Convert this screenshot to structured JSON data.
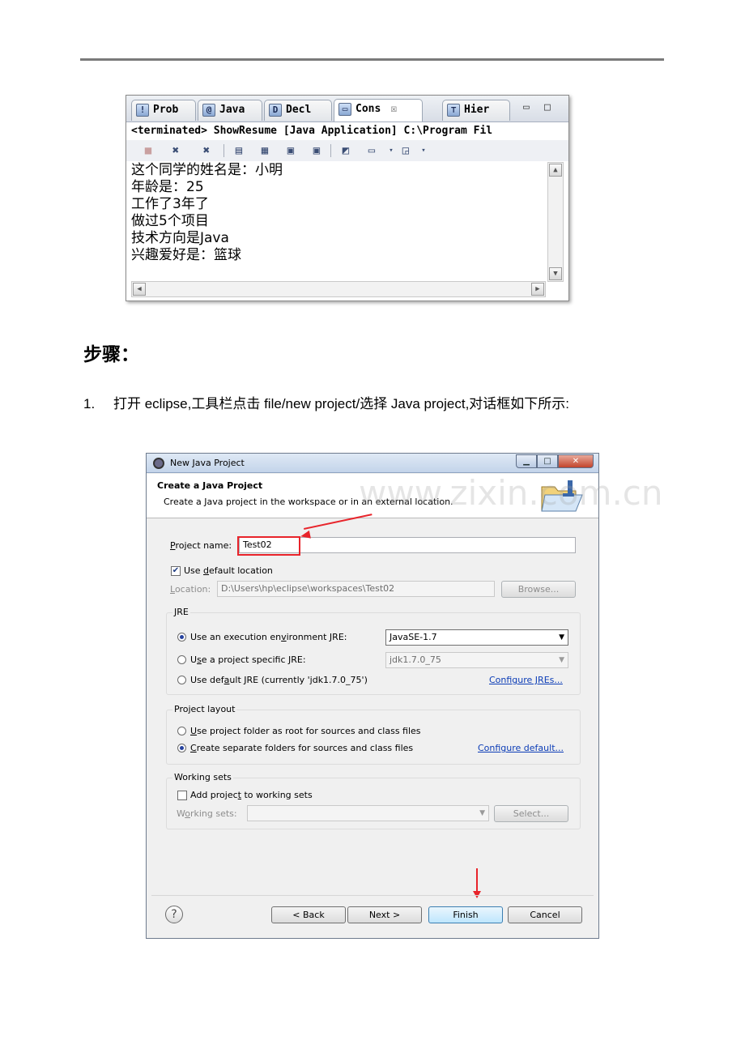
{
  "console": {
    "tabs": [
      {
        "label": "Prob",
        "icon": "problems-icon"
      },
      {
        "label": "Java",
        "icon": "javadoc-icon"
      },
      {
        "label": "Decl",
        "icon": "declaration-icon"
      },
      {
        "label": "Cons",
        "icon": "console-icon",
        "active": true
      },
      {
        "label": "Hier",
        "icon": "hierarchy-icon"
      }
    ],
    "close_glyph": "☒",
    "status": "<terminated> ShowResume [Java Application] C:\\Program Fil",
    "output_lines": [
      "这个同学的姓名是：小明",
      "年龄是：25",
      "工作了3年了",
      "做过5个项目",
      "技术方向是Java",
      "兴趣爱好是：篮球"
    ]
  },
  "heading": "步骤：",
  "step1": {
    "number": "1.",
    "text": "打开 eclipse,工具栏点击 file/new project/选择 Java project,对话框如下所示:"
  },
  "dialog": {
    "title": "New Java Project",
    "banner_heading": "Create a Java Project",
    "banner_desc": "Create a Java project in the workspace or in an external location.",
    "watermark": "www.zixin.com.cn",
    "project_name_label_u": "P",
    "project_name_label_rest": "roject name:",
    "project_name_value": "Test02",
    "use_default_pre": "Use ",
    "use_default_u": "d",
    "use_default_post": "efault location",
    "location_label_u": "L",
    "location_label_rest": "ocation:",
    "location_value": "D:\\Users\\hp\\eclipse\\workspaces\\Test02",
    "browse_label": "Browse...",
    "jre_group": "JRE",
    "jre_opt1_pre": "Use an execution en",
    "jre_opt1_u": "v",
    "jre_opt1_post": "ironment JRE:",
    "jre_opt1_value": "JavaSE-1.7",
    "jre_opt2_pre": "U",
    "jre_opt2_u": "s",
    "jre_opt2_post": "e a project specific JRE:",
    "jre_opt2_value": "jdk1.7.0_75",
    "jre_opt3_pre": "Use def",
    "jre_opt3_u": "a",
    "jre_opt3_post": "ult JRE (currently 'jdk1.7.0_75')",
    "configure_jres": "Configure JREs...",
    "layout_group": "Project layout",
    "layout_opt1_u": "U",
    "layout_opt1_rest": "se project folder as root for sources and class files",
    "layout_opt2_u": "C",
    "layout_opt2_rest": "reate separate folders for sources and class files",
    "configure_default": "Configure default...",
    "ws_group": "Working sets",
    "ws_check_pre": "Add projec",
    "ws_check_u": "t",
    "ws_check_post": " to working sets",
    "ws_label_pre": "W",
    "ws_label_u": "o",
    "ws_label_post": "rking sets:",
    "select_label": "Select...",
    "back_label": "< Back",
    "next_label": "Next >",
    "finish_label": "Finish",
    "cancel_label": "Cancel",
    "help_glyph": "?",
    "min_glyph": "▁",
    "max_glyph": "□",
    "close_glyph": "✕",
    "accent_color": "#e8242b"
  }
}
